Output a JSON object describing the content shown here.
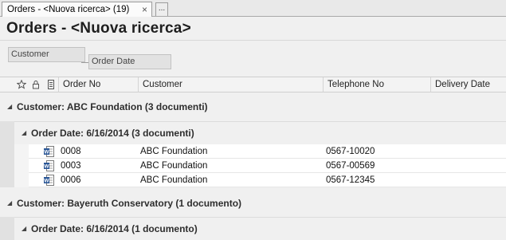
{
  "tab": {
    "label": "Orders - <Nuova ricerca> (19)",
    "close": "×",
    "more": "..."
  },
  "page": {
    "title": "Orders - <Nuova ricerca>"
  },
  "grouping": {
    "chips": [
      "Customer",
      "Order Date"
    ]
  },
  "header": {
    "icons": [
      "star-icon",
      "lock-icon",
      "document-icon"
    ],
    "columns": [
      "Order No",
      "Customer",
      "Telephone No",
      "Delivery Date"
    ]
  },
  "groups": [
    {
      "label": "Customer: ABC Foundation (3 documenti)",
      "subgroups": [
        {
          "label": "Order Date: 6/16/2014 (3 documenti)",
          "rows": [
            {
              "order_no": "0008",
              "customer": "ABC Foundation",
              "telephone": "0567-10020",
              "icon": "word-document-icon"
            },
            {
              "order_no": "0003",
              "customer": "ABC Foundation",
              "telephone": "0567-00569",
              "icon": "word-document-icon"
            },
            {
              "order_no": "0006",
              "customer": "ABC Foundation",
              "telephone": "0567-12345",
              "icon": "word-document-icon"
            }
          ]
        }
      ]
    },
    {
      "label": "Customer: Bayeruth Conservatory (1 documento)",
      "subgroups": [
        {
          "label": "Order Date: 6/16/2014 (1 documento)",
          "rows": []
        }
      ]
    }
  ],
  "colors": {
    "word_blue": "#2b5797",
    "group_band": "#e1e1e1"
  }
}
